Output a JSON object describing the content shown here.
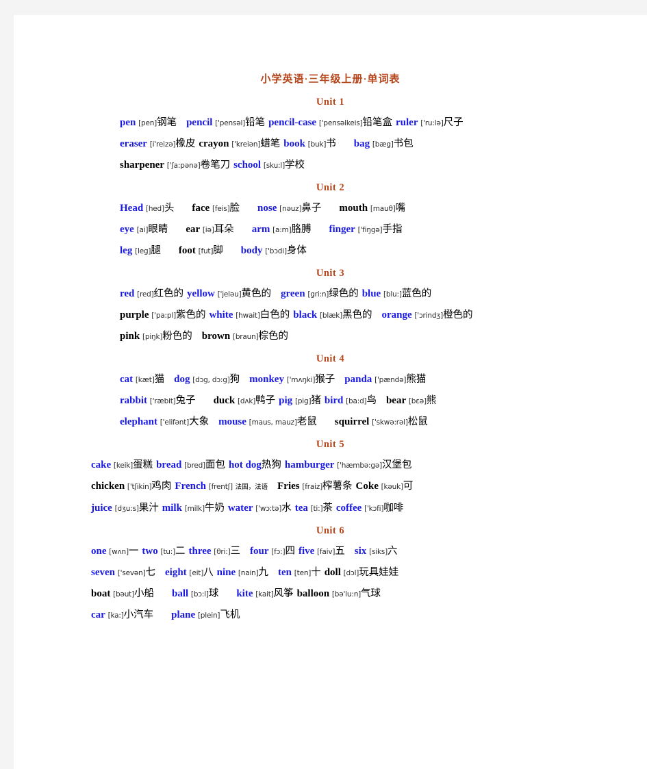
{
  "document": {
    "title": "小学英语·三年级上册·单词表",
    "accent_color": "#b5451b",
    "word_blue": "#1a1ae0",
    "word_black": "#000000",
    "page_background": "#ffffff",
    "canvas_background": "#f4f4f4"
  },
  "units": [
    {
      "heading": "Unit 1",
      "indent": "a",
      "lines": [
        [
          {
            "word": "pen",
            "color": "blue",
            "phonetic": "[pen]",
            "cn": "钢笔",
            "gap_after": 2
          },
          {
            "word": "pencil",
            "color": "blue",
            "phonetic": "['pensəl]",
            "cn": "铅笔",
            "gap_after": 1
          },
          {
            "word": "pencil-case",
            "color": "blue",
            "phonetic": "['pensəlkeis]",
            "cn": "铅笔盒",
            "gap_after": 1
          },
          {
            "word": "ruler",
            "color": "blue",
            "phonetic": "['ru:lə]",
            "cn": "尺子",
            "gap_after": 0
          }
        ],
        [
          {
            "word": "eraser",
            "color": "blue",
            "phonetic": "[i'reizə]",
            "cn": "橡皮",
            "gap_after": 1
          },
          {
            "word": "crayon",
            "color": "black",
            "phonetic": "['kreiən]",
            "cn": "蜡笔",
            "gap_after": 1
          },
          {
            "word": "book",
            "color": "blue",
            "phonetic": "[buk]",
            "cn": "书",
            "gap_after": 3
          },
          {
            "word": "bag",
            "color": "blue",
            "phonetic": "[bæg]",
            "cn": "书包",
            "gap_after": 0
          }
        ],
        [
          {
            "word": "sharpener",
            "color": "black",
            "phonetic": "['ʃa:pənə]",
            "cn": "卷笔刀",
            "gap_after": 1
          },
          {
            "word": "school",
            "color": "blue",
            "phonetic": "[sku:l]",
            "cn": "学校",
            "gap_after": 0
          }
        ]
      ]
    },
    {
      "heading": "Unit 2",
      "indent": "a",
      "lines": [
        [
          {
            "word": "Head",
            "color": "blue",
            "phonetic": "[hed]",
            "cn": "头",
            "gap_after": 3
          },
          {
            "word": "face",
            "color": "black",
            "phonetic": "[feis]",
            "cn": "脸",
            "gap_after": 3
          },
          {
            "word": "nose",
            "color": "blue",
            "phonetic": "[nəuz]",
            "cn": "鼻子",
            "gap_after": 3
          },
          {
            "word": "mouth",
            "color": "black",
            "phonetic": "[mauθ]",
            "cn": "嘴",
            "gap_after": 0
          }
        ],
        [
          {
            "word": "eye",
            "color": "blue",
            "phonetic": "[ai]",
            "cn": "眼睛",
            "gap_after": 3
          },
          {
            "word": "ear",
            "color": "black",
            "phonetic": "[iə]",
            "cn": "耳朵",
            "gap_after": 3
          },
          {
            "word": "arm",
            "color": "blue",
            "phonetic": "[a:m]",
            "cn": "胳膊",
            "gap_after": 3
          },
          {
            "word": "finger",
            "color": "blue",
            "phonetic": "['fiŋgə]",
            "cn": "手指",
            "gap_after": 0
          }
        ],
        [
          {
            "word": "leg",
            "color": "blue",
            "phonetic": "[leg]",
            "cn": "腿",
            "gap_after": 3
          },
          {
            "word": "foot",
            "color": "black",
            "phonetic": "[fut]",
            "cn": "脚",
            "gap_after": 3
          },
          {
            "word": "body",
            "color": "blue",
            "phonetic": "['bɔdi]",
            "cn": "身体",
            "gap_after": 0
          }
        ]
      ]
    },
    {
      "heading": "Unit 3",
      "indent": "a",
      "lines": [
        [
          {
            "word": "red",
            "color": "blue",
            "phonetic": "[red]",
            "cn": "红色的",
            "gap_after": 1
          },
          {
            "word": "yellow",
            "color": "blue",
            "phonetic": "['jeləu]",
            "cn": "黄色的",
            "gap_after": 2
          },
          {
            "word": "green",
            "color": "blue",
            "phonetic": "[gri:n]",
            "cn": "绿色的",
            "gap_after": 1
          },
          {
            "word": "blue",
            "color": "blue",
            "phonetic": "[blu:]",
            "cn": "蓝色的",
            "gap_after": 0
          }
        ],
        [
          {
            "word": "purple",
            "color": "black",
            "phonetic": "['pa:pl]",
            "cn": "紫色的",
            "gap_after": 1
          },
          {
            "word": "white",
            "color": "blue",
            "phonetic": "[hwait]",
            "cn": "白色的",
            "gap_after": 1
          },
          {
            "word": "black",
            "color": "blue",
            "phonetic": "[blæk]",
            "cn": "黑色的",
            "gap_after": 2
          },
          {
            "word": "orange",
            "color": "blue",
            "phonetic": "['ɔrindʒ]",
            "cn": "橙色的",
            "gap_after": 0
          }
        ],
        [
          {
            "word": "pink",
            "color": "black",
            "phonetic": "[piŋk]",
            "cn": "粉色的",
            "gap_after": 2
          },
          {
            "word": "brown",
            "color": "black",
            "phonetic": "[braun]",
            "cn": "棕色的",
            "gap_after": 0
          }
        ]
      ]
    },
    {
      "heading": "Unit  4",
      "indent": "a",
      "lines": [
        [
          {
            "word": "cat",
            "color": "blue",
            "phonetic": "[kæt]",
            "cn": "猫",
            "gap_after": 2
          },
          {
            "word": "dog",
            "color": "blue",
            "phonetic": "[dɔg, dɔ:g]",
            "cn": "狗",
            "gap_after": 2
          },
          {
            "word": "monkey",
            "color": "blue",
            "phonetic": "['mʌŋki]",
            "cn": "猴子",
            "gap_after": 2
          },
          {
            "word": "panda",
            "color": "blue",
            "phonetic": "['pændə]",
            "cn": "熊猫",
            "gap_after": 0
          }
        ],
        [
          {
            "word": "rabbit",
            "color": "blue",
            "phonetic": "['ræbit]",
            "cn": "兔子",
            "gap_after": 3
          },
          {
            "word": "duck",
            "color": "black",
            "phonetic": "[dʌk]",
            "cn": "鸭子",
            "gap_after": 1
          },
          {
            "word": "pig",
            "color": "blue",
            "phonetic": "[pig]",
            "cn": "猪",
            "gap_after": 1
          },
          {
            "word": "bird",
            "color": "blue",
            "phonetic": "[ba:d]",
            "cn": "鸟",
            "gap_after": 2
          },
          {
            "word": "bear",
            "color": "black",
            "phonetic": "[bɛə]",
            "cn": "熊",
            "gap_after": 0
          }
        ],
        [
          {
            "word": "elephant",
            "color": "blue",
            "phonetic": "['elifənt]",
            "cn": "大象",
            "gap_after": 2
          },
          {
            "word": "mouse",
            "color": "blue",
            "phonetic": "[maus, mauz]",
            "cn": "老鼠",
            "gap_after": 3
          },
          {
            "word": "squirrel",
            "color": "black",
            "phonetic": "['skwə:rəl]",
            "cn": "松鼠",
            "gap_after": 0
          }
        ]
      ]
    },
    {
      "heading": "Unit  5",
      "indent": "b",
      "lines": [
        [
          {
            "word": "cake",
            "color": "blue",
            "phonetic": "[keik]",
            "cn": "蛋糕",
            "gap_after": 1
          },
          {
            "word": "bread",
            "color": "blue",
            "phonetic": "[bred]",
            "cn": "面包",
            "gap_after": 1
          },
          {
            "word": "hot dog",
            "color": "blue",
            "phonetic": "",
            "cn": "热狗",
            "gap_after": 1
          },
          {
            "word": "hamburger",
            "color": "blue",
            "phonetic": "['hæmbə:gə]",
            "cn": "汉堡包",
            "gap_after": 0
          }
        ],
        [
          {
            "word": "chicken",
            "color": "black",
            "phonetic": "['tʃikin]",
            "cn": "鸡肉",
            "gap_after": 1
          },
          {
            "word": "French",
            "color": "blue",
            "phonetic": "[frentʃ]",
            "cn": "法国，法语",
            "cn_small": true,
            "gap_after": 2
          },
          {
            "word": "Fries",
            "color": "black",
            "phonetic": "[fraiz]",
            "cn": "榨薯条",
            "gap_after": 1
          },
          {
            "word": "Coke",
            "color": "black",
            "phonetic": "[kəuk]",
            "cn": "可",
            "gap_after": 0
          }
        ],
        [
          {
            "word": "juice",
            "color": "blue",
            "phonetic": "[dʒu:s]",
            "cn": "果汁",
            "gap_after": 1
          },
          {
            "word": "milk",
            "color": "blue",
            "phonetic": "[milk]",
            "cn": "牛奶",
            "gap_after": 1
          },
          {
            "word": "water",
            "color": "blue",
            "phonetic": "['wɔ:tə]",
            "cn": "水",
            "gap_after": 1
          },
          {
            "word": "tea",
            "color": "blue",
            "phonetic": "[ti:]",
            "cn": "茶",
            "gap_after": 1
          },
          {
            "word": "coffee",
            "color": "blue",
            "phonetic": "['kɔfi]",
            "cn": "咖啡",
            "gap_after": 0
          }
        ]
      ]
    },
    {
      "heading": "Unit  6",
      "indent": "b",
      "lines": [
        [
          {
            "word": "one",
            "color": "blue",
            "phonetic": "[wʌn]",
            "cn": "一",
            "gap_after": 1
          },
          {
            "word": "two",
            "color": "blue",
            "phonetic": "[tu:]",
            "cn": "二",
            "gap_after": 1
          },
          {
            "word": "three",
            "color": "blue",
            "phonetic": "[θri:]",
            "cn": "三",
            "gap_after": 2
          },
          {
            "word": "four",
            "color": "blue",
            "phonetic": "[fɔ:]",
            "cn": "四",
            "gap_after": 1
          },
          {
            "word": "five",
            "color": "blue",
            "phonetic": "[faiv]",
            "cn": "五",
            "gap_after": 2
          },
          {
            "word": "six",
            "color": "blue",
            "phonetic": "[siks]",
            "cn": "六",
            "gap_after": 0
          }
        ],
        [
          {
            "word": "seven",
            "color": "blue",
            "phonetic": "['sevən]",
            "cn": "七",
            "gap_after": 2
          },
          {
            "word": "eight",
            "color": "blue",
            "phonetic": "[eit]",
            "cn": "八",
            "gap_after": 1
          },
          {
            "word": "nine",
            "color": "blue",
            "phonetic": "[nain]",
            "cn": "九",
            "gap_after": 2
          },
          {
            "word": "ten",
            "color": "blue",
            "phonetic": "[ten]",
            "cn": "十",
            "gap_after": 1
          },
          {
            "word": "doll",
            "color": "black",
            "phonetic": "[dɔl]",
            "cn": "玩具娃娃",
            "gap_after": 0
          }
        ],
        [
          {
            "word": "boat",
            "color": "black",
            "phonetic": "[bəut]",
            "cn": "小船",
            "gap_after": 3
          },
          {
            "word": "ball",
            "color": "blue",
            "phonetic": "[bɔ:l]",
            "cn": "球",
            "gap_after": 3
          },
          {
            "word": "kite",
            "color": "blue",
            "phonetic": "[kait]",
            "cn": "风筝",
            "gap_after": 1
          },
          {
            "word": "balloon",
            "color": "black",
            "phonetic": "[bə'lu:n]",
            "cn": "气球",
            "gap_after": 0
          }
        ],
        [
          {
            "word": "car",
            "color": "blue",
            "phonetic": "[ka:]",
            "cn": "小汽车",
            "gap_after": 3
          },
          {
            "word": "plane",
            "color": "blue",
            "phonetic": "[plein]",
            "cn": "飞机",
            "gap_after": 0
          }
        ]
      ]
    }
  ]
}
